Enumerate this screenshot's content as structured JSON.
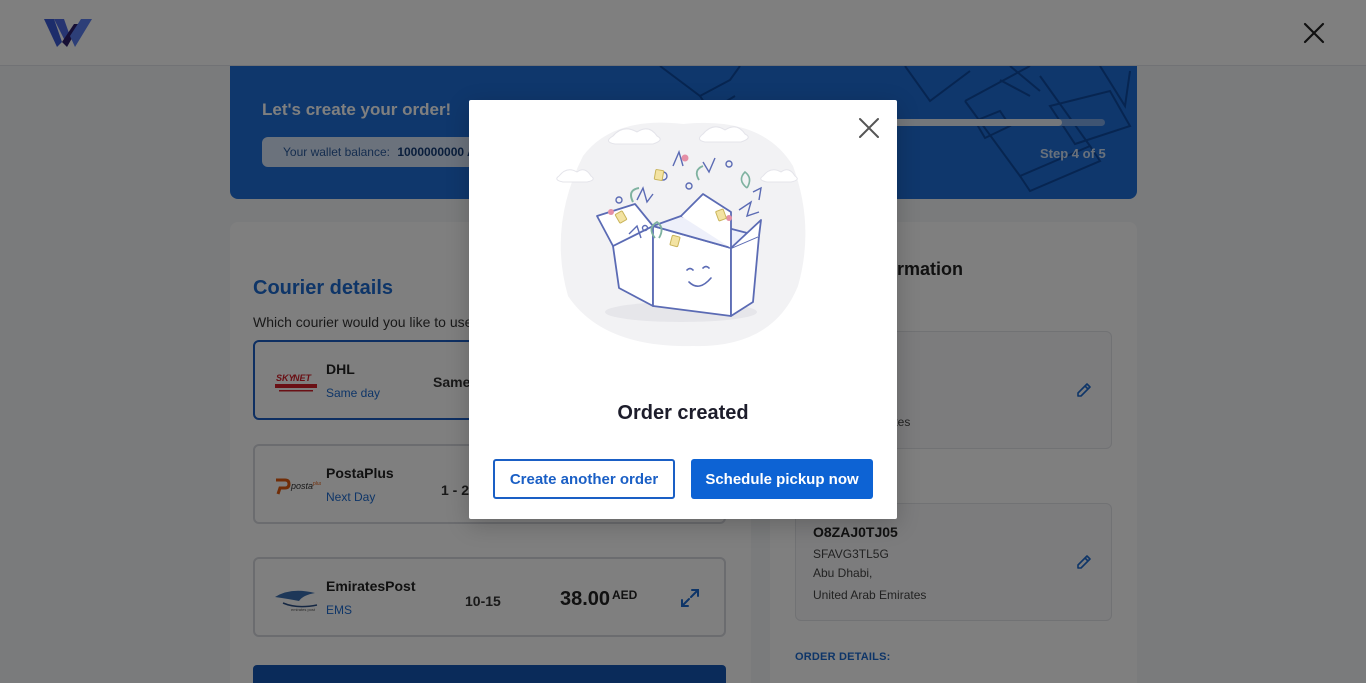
{
  "header": {
    "logo_icon": "brand-w-logo",
    "close_icon": "close-icon"
  },
  "banner": {
    "title": "Let's create your order!",
    "wallet_label": "Your wallet balance:",
    "wallet_value": "1000000000 A",
    "step": "Step 4 of 5",
    "progress_fraction": 0.8
  },
  "courier": {
    "title": "Courier details",
    "question": "Which courier would you like to use?",
    "options": [
      {
        "name": "DHL",
        "speed": "Same day",
        "days": "Same",
        "logo": "skynet-logo"
      },
      {
        "name": "PostaPlus",
        "speed": "Next Day",
        "days": "1 - 2",
        "logo": "postaplus-logo"
      },
      {
        "name": "EmiratesPost",
        "speed": "EMS",
        "days": "10-15",
        "price": "38.00",
        "currency": "AED",
        "logo": "emiratespost-logo"
      }
    ]
  },
  "info": {
    "title": "formation",
    "sender_country": "irates",
    "receiver_label": ":",
    "receiver": {
      "code": "O8ZAJ0TJ05",
      "ref": "SFAVG3TL5G",
      "city": "Abu Dhabi,",
      "country": "United Arab Emirates"
    },
    "order_details_label": "ORDER DETAILS:"
  },
  "modal": {
    "title": "Order created",
    "illustration": "celebration-box-illustration",
    "secondary_button": "Create another order",
    "primary_button": "Schedule pickup now"
  },
  "colors": {
    "brand_blue": "#1e6fd9",
    "primary_button": "#0d63d4",
    "overlay": "rgba(0,0,0,0.5)"
  }
}
